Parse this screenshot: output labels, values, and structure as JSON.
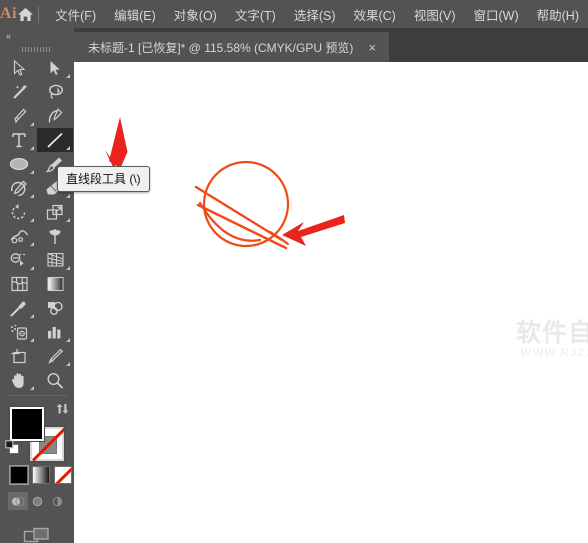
{
  "app": {
    "logo_text": "Ai",
    "home_icon": "home-icon"
  },
  "menubar": {
    "items": [
      {
        "label": "文件(F)",
        "name": "menu-file"
      },
      {
        "label": "编辑(E)",
        "name": "menu-edit"
      },
      {
        "label": "对象(O)",
        "name": "menu-object"
      },
      {
        "label": "文字(T)",
        "name": "menu-type"
      },
      {
        "label": "选择(S)",
        "name": "menu-select"
      },
      {
        "label": "效果(C)",
        "name": "menu-effect"
      },
      {
        "label": "视图(V)",
        "name": "menu-view"
      },
      {
        "label": "窗口(W)",
        "name": "menu-window"
      },
      {
        "label": "帮助(H)",
        "name": "menu-help"
      }
    ]
  },
  "tabbar": {
    "document_title": "未标题-1 [已恢复]* @ 115.58% (CMYK/GPU 预览)",
    "close_label": "×"
  },
  "toolbar": {
    "collapse_label": "«",
    "tools": [
      {
        "name": "selection-tool",
        "icon": "arrow-cursor-icon",
        "corner": false,
        "selected": false
      },
      {
        "name": "direct-selection-tool",
        "icon": "direct-select-arrow-icon",
        "corner": true,
        "selected": false
      },
      {
        "name": "magic-wand-tool",
        "icon": "magic-wand-icon",
        "corner": false,
        "selected": false
      },
      {
        "name": "lasso-tool",
        "icon": "lasso-icon",
        "corner": false,
        "selected": false
      },
      {
        "name": "pen-tool",
        "icon": "pen-icon",
        "corner": true,
        "selected": false
      },
      {
        "name": "curvature-tool",
        "icon": "curvature-icon",
        "corner": false,
        "selected": false
      },
      {
        "name": "type-tool",
        "icon": "type-t-icon",
        "corner": true,
        "selected": false
      },
      {
        "name": "line-segment-tool",
        "icon": "line-segment-icon",
        "corner": true,
        "selected": true
      },
      {
        "name": "ellipse-tool",
        "icon": "ellipse-icon",
        "corner": true,
        "selected": false
      },
      {
        "name": "paintbrush-tool",
        "icon": "paintbrush-icon",
        "corner": true,
        "selected": false
      },
      {
        "name": "shaper-tool",
        "icon": "shaper-pencil-icon",
        "corner": true,
        "selected": false
      },
      {
        "name": "eraser-tool",
        "icon": "eraser-icon",
        "corner": true,
        "selected": false
      },
      {
        "name": "rotate-tool",
        "icon": "rotate-icon",
        "corner": true,
        "selected": false
      },
      {
        "name": "scale-tool",
        "icon": "scale-icon",
        "corner": true,
        "selected": false
      },
      {
        "name": "width-tool",
        "icon": "width-warp-icon",
        "corner": true,
        "selected": false
      },
      {
        "name": "free-transform-tool",
        "icon": "pushpin-icon",
        "corner": false,
        "selected": false
      },
      {
        "name": "shape-builder-tool",
        "icon": "shape-builder-icon",
        "corner": true,
        "selected": false
      },
      {
        "name": "perspective-grid-tool",
        "icon": "perspective-grid-icon",
        "corner": true,
        "selected": false
      },
      {
        "name": "mesh-tool",
        "icon": "mesh-icon",
        "corner": false,
        "selected": false
      },
      {
        "name": "gradient-tool",
        "icon": "gradient-icon",
        "corner": false,
        "selected": false
      },
      {
        "name": "eyedropper-tool",
        "icon": "eyedropper-icon",
        "corner": true,
        "selected": false
      },
      {
        "name": "blend-tool",
        "icon": "blend-icon",
        "corner": false,
        "selected": false
      },
      {
        "name": "symbol-sprayer-tool",
        "icon": "symbol-sprayer-icon",
        "corner": true,
        "selected": false
      },
      {
        "name": "column-graph-tool",
        "icon": "bar-chart-icon",
        "corner": true,
        "selected": false
      },
      {
        "name": "artboard-tool",
        "icon": "artboard-icon",
        "corner": false,
        "selected": false
      },
      {
        "name": "slice-tool",
        "icon": "slice-knife-icon",
        "corner": true,
        "selected": false
      },
      {
        "name": "hand-tool",
        "icon": "hand-icon",
        "corner": true,
        "selected": false
      },
      {
        "name": "zoom-tool",
        "icon": "magnifier-icon",
        "corner": false,
        "selected": false
      }
    ],
    "fill_color": "#000000",
    "stroke_color": "none",
    "swap_icon": "swap-fill-stroke-icon",
    "default_icon": "default-fill-stroke-icon",
    "color_modes": [
      {
        "name": "fill-color-solid",
        "type": "solid",
        "selected": true
      },
      {
        "name": "fill-color-gradient",
        "type": "gradient",
        "selected": false
      },
      {
        "name": "fill-color-none",
        "type": "none",
        "selected": false
      }
    ],
    "draw_modes": [
      {
        "name": "draw-normal-mode",
        "icon": "draw-normal-icon",
        "selected": true
      },
      {
        "name": "draw-behind-mode",
        "icon": "draw-behind-icon",
        "selected": false
      },
      {
        "name": "draw-inside-mode",
        "icon": "draw-inside-icon",
        "selected": false
      }
    ],
    "screen_mode": {
      "name": "change-screen-mode",
      "icon": "screen-mode-icon"
    }
  },
  "tooltip": {
    "text": "直线段工具 (\\)"
  },
  "canvas": {
    "artwork_name": "circle-with-lines-sketch",
    "artwork_stroke_color": "#ef4a18",
    "watermark": {
      "chinese": "软件自学网",
      "url": "WWW.RJZXW.COM"
    }
  },
  "annotations": [
    {
      "name": "annotation-arrow-to-tooltip",
      "color": "#e8241c",
      "direction": "down"
    },
    {
      "name": "annotation-arrow-to-artwork",
      "color": "#e8241c",
      "direction": "left"
    }
  ],
  "colors": {
    "chrome_bg": "#535353",
    "tabbar_bg": "#3d3d3d",
    "canvas_bg": "#ffffff",
    "accent_orange": "#cd8b64",
    "annotation_red": "#e8241c",
    "art_orange": "#ef4a18"
  }
}
